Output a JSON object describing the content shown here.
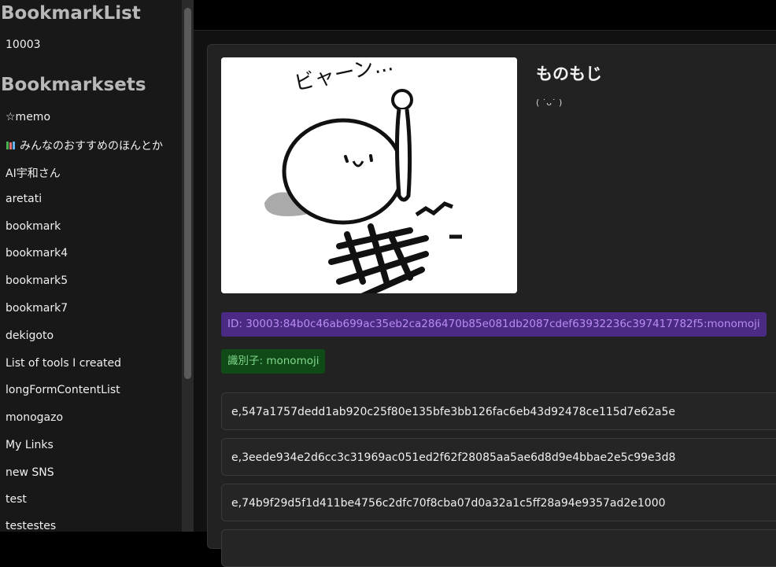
{
  "sidebar": {
    "bookmark_list_heading": "BookmarkList",
    "bookmark_list_items": [
      "10003"
    ],
    "bookmarksets_heading": "Bookmarksets",
    "bookmarksets_items": [
      "☆memo",
      "みんなのおすすめのほんとか",
      "AI宇和さん",
      "aretati",
      "bookmark",
      "bookmark4",
      "bookmark5",
      "bookmark7",
      "dekigoto",
      "List of tools I created",
      "longFormContentList",
      "monogazo",
      "My Links",
      "new SNS",
      "test",
      "testestes"
    ],
    "book_icon": "books-icon"
  },
  "profile": {
    "name": "ものもじ",
    "subtitle": "( ˙ᴗ˙ )",
    "avatar_text": "ビャーン...",
    "id_badge": "ID: 30003:84b0c46ab699ac35eb2ca286470b85e081db2087cdef63932236c397417782f5:monomoji",
    "identifier_badge": "識別子: monomoji"
  },
  "tags": [
    "e,547a1757dedd1ab920c25f80e135bfe3bb126fac6eb43d92478ce115d7e62a5e",
    "e,3eede934e2d6cc3c31969ac051ed2f62f28085aa5ae6d8d9e4bbae2e5c99e3d8",
    "e,74b9f29d5f1d411be4756c2dfc70f8cba07d0a32a1c5ff28a94e9357ad2e1000"
  ],
  "colors": {
    "id_badge_bg": "#4a2a82",
    "id_badge_fg": "#b98cf3",
    "identifier_badge_bg": "#0f4a17",
    "identifier_badge_fg": "#7fd88c"
  }
}
